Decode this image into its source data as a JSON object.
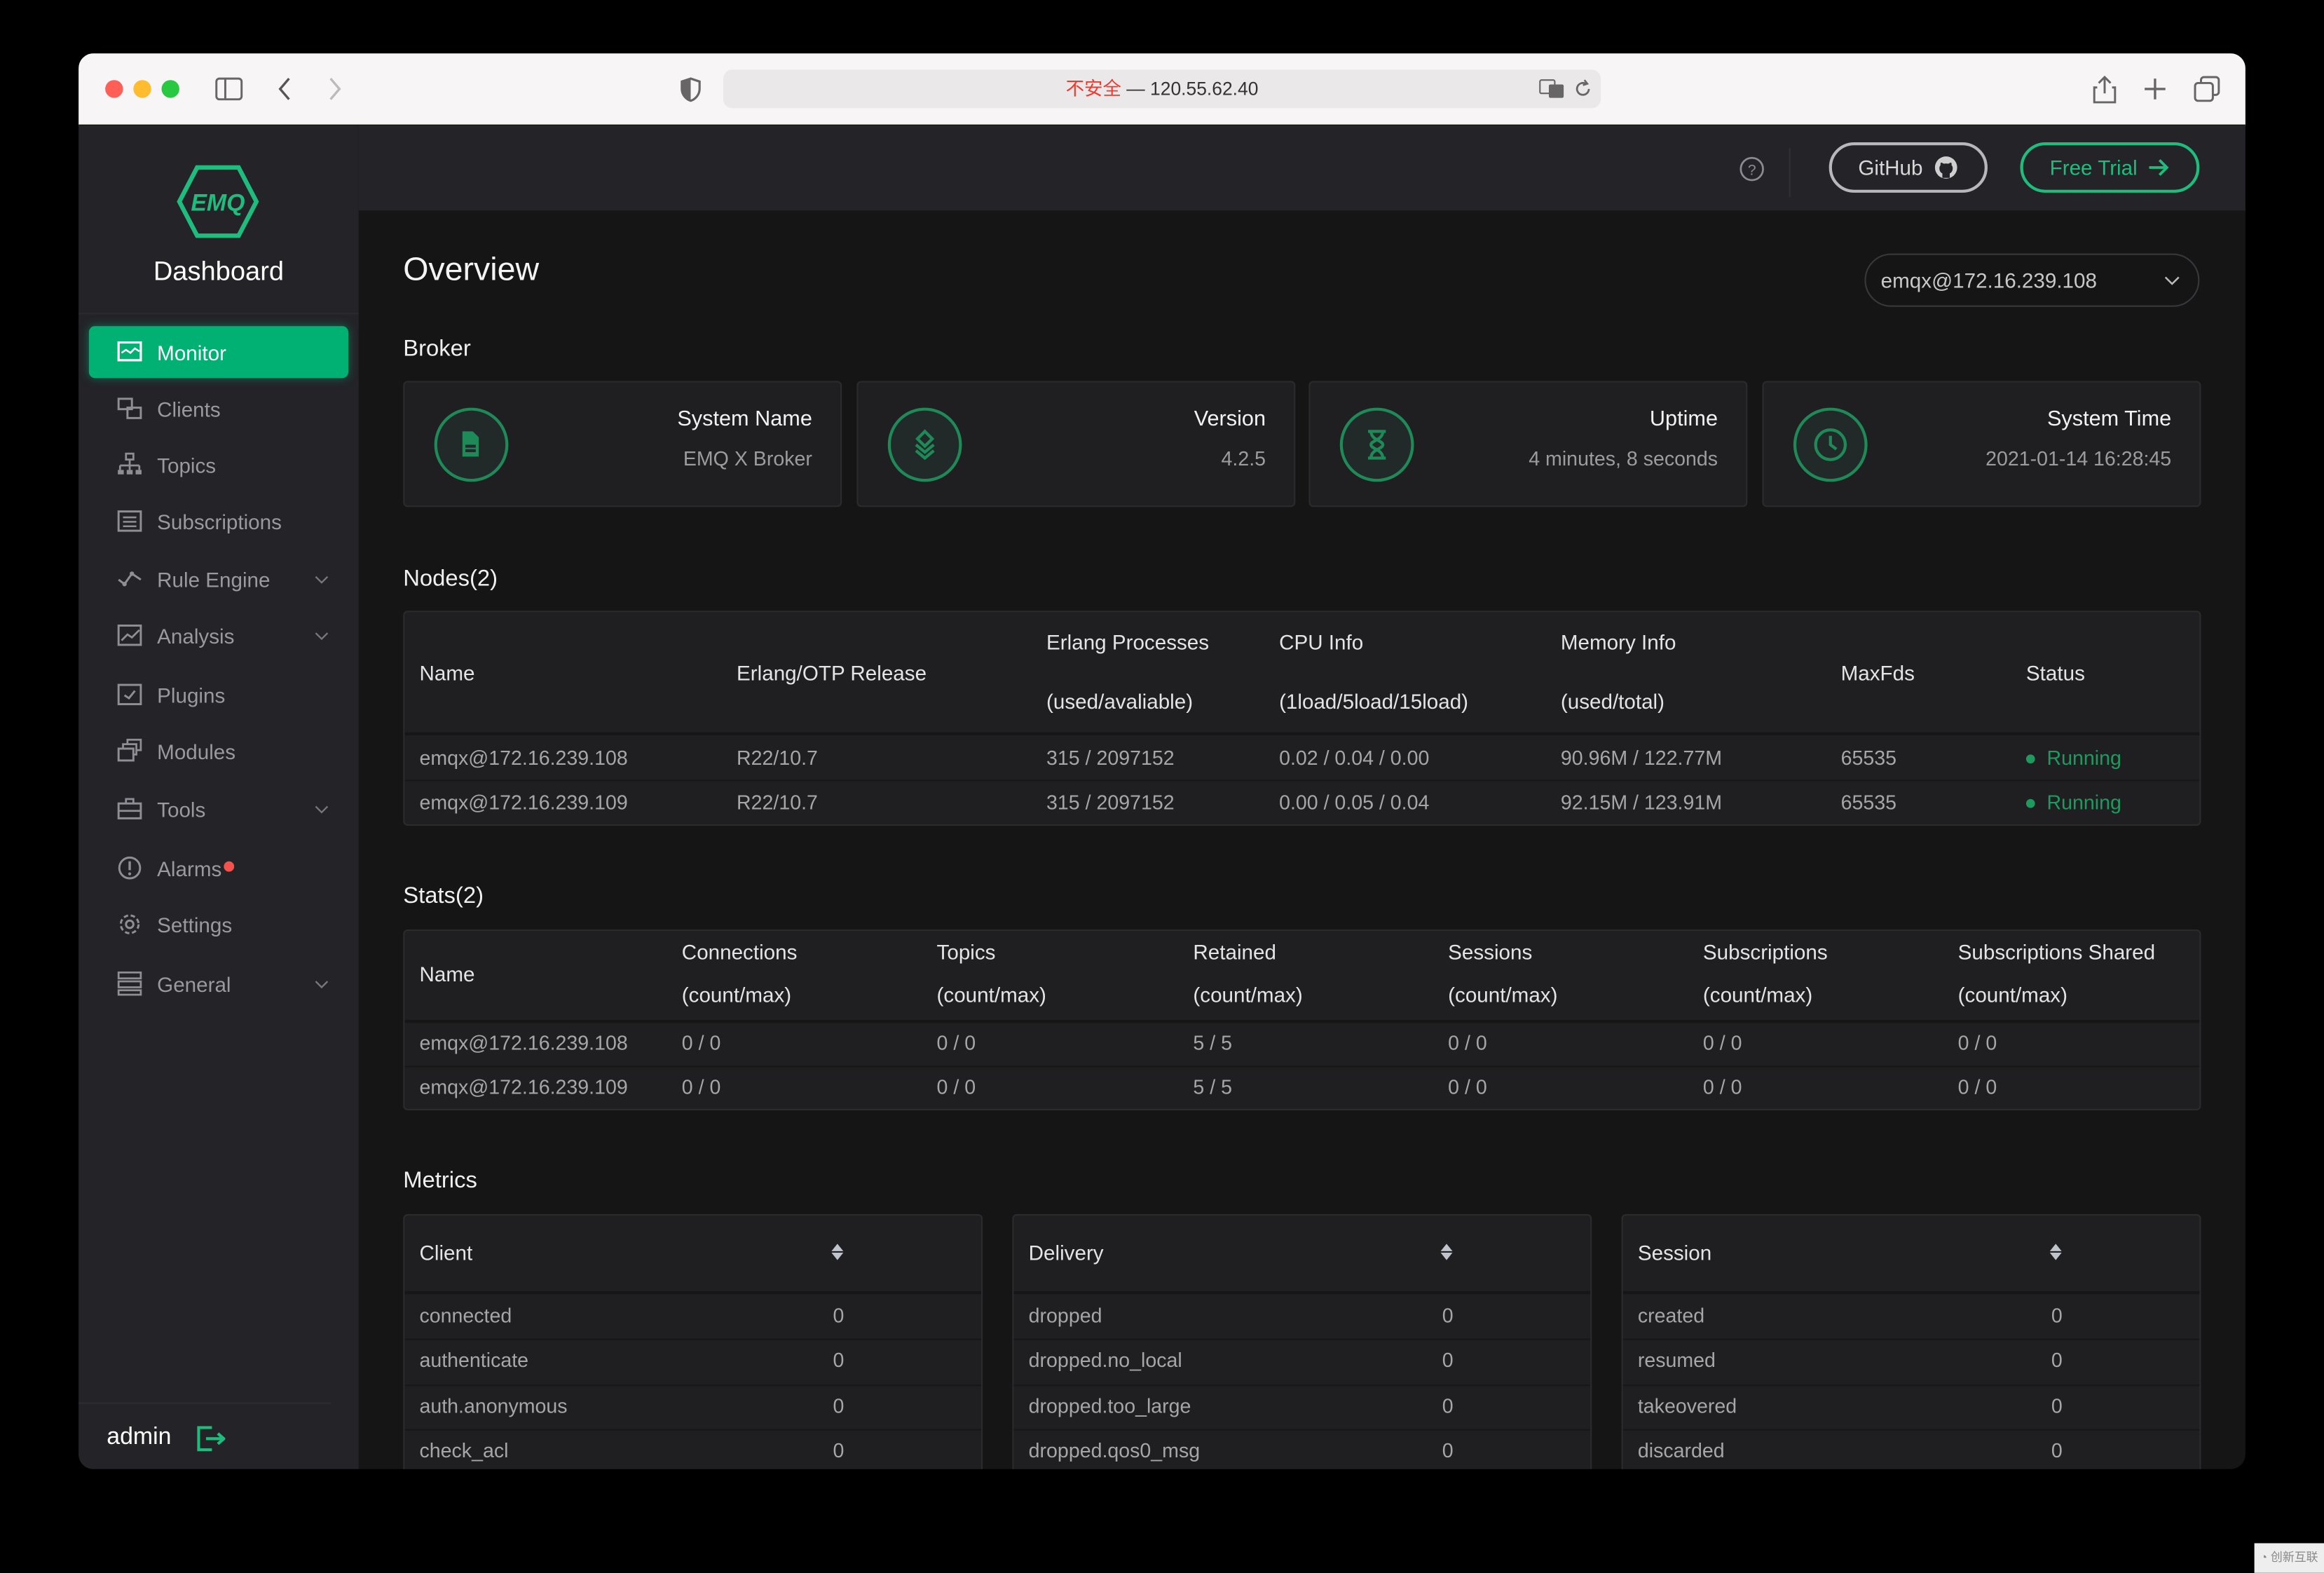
{
  "browser": {
    "address_insecure": "不安全",
    "address_sep": " — ",
    "address_host": "120.55.62.40"
  },
  "sidebar": {
    "logo_text": "EMQ",
    "title": "Dashboard",
    "items": [
      {
        "label": "Monitor",
        "icon": "monitor-icon",
        "active": true
      },
      {
        "label": "Clients",
        "icon": "clients-icon"
      },
      {
        "label": "Topics",
        "icon": "topics-icon"
      },
      {
        "label": "Subscriptions",
        "icon": "subscriptions-icon"
      },
      {
        "label": "Rule Engine",
        "icon": "rule-engine-icon",
        "expandable": true
      },
      {
        "label": "Analysis",
        "icon": "analysis-icon",
        "expandable": true
      },
      {
        "label": "Plugins",
        "icon": "plugins-icon"
      },
      {
        "label": "Modules",
        "icon": "modules-icon"
      },
      {
        "label": "Tools",
        "icon": "tools-icon",
        "expandable": true
      },
      {
        "label": "Alarms",
        "icon": "alarm-icon",
        "badge_dot": true
      },
      {
        "label": "Settings",
        "icon": "gear-icon"
      },
      {
        "label": "General",
        "icon": "general-icon",
        "expandable": true
      }
    ],
    "user": "admin"
  },
  "header": {
    "github_label": "GitHub",
    "free_trial_label": "Free Trial"
  },
  "page": {
    "title": "Overview",
    "node_select": "emqx@172.16.239.108",
    "broker_label": "Broker",
    "nodes_label": "Nodes(2)",
    "stats_label": "Stats(2)",
    "metrics_label": "Metrics"
  },
  "broker_cards": [
    {
      "title": "System Name",
      "value": "EMQ X Broker",
      "icon": "document-icon"
    },
    {
      "title": "Version",
      "value": "4.2.5",
      "icon": "layers-icon"
    },
    {
      "title": "Uptime",
      "value": "4 minutes, 8 seconds",
      "icon": "hourglass-icon"
    },
    {
      "title": "System Time",
      "value": "2021-01-14 16:28:45",
      "icon": "clock-icon"
    }
  ],
  "nodes": {
    "columns": [
      {
        "l1": "Name"
      },
      {
        "l1": "Erlang/OTP Release"
      },
      {
        "l1": "Erlang Processes",
        "l2": "(used/avaliable)"
      },
      {
        "l1": "CPU Info",
        "l2": "(1load/5load/15load)"
      },
      {
        "l1": "Memory Info",
        "l2": "(used/total)"
      },
      {
        "l1": "MaxFds"
      },
      {
        "l1": "Status"
      }
    ],
    "rows": [
      [
        "emqx@172.16.239.108",
        "R22/10.7",
        "315 / 2097152",
        "0.02 / 0.04 / 0.00",
        "90.96M / 122.77M",
        "65535",
        "Running"
      ],
      [
        "emqx@172.16.239.109",
        "R22/10.7",
        "315 / 2097152",
        "0.00 / 0.05 / 0.04",
        "92.15M / 123.91M",
        "65535",
        "Running"
      ]
    ]
  },
  "stats": {
    "columns": [
      {
        "l1": "Name"
      },
      {
        "l1": "Connections",
        "l2": "(count/max)"
      },
      {
        "l1": "Topics",
        "l2": "(count/max)"
      },
      {
        "l1": "Retained",
        "l2": "(count/max)"
      },
      {
        "l1": "Sessions",
        "l2": "(count/max)"
      },
      {
        "l1": "Subscriptions",
        "l2": "(count/max)"
      },
      {
        "l1": "Subscriptions Shared",
        "l2": "(count/max)"
      }
    ],
    "rows": [
      [
        "emqx@172.16.239.108",
        "0 / 0",
        "0 / 0",
        "5 / 5",
        "0 / 0",
        "0 / 0",
        "0 / 0"
      ],
      [
        "emqx@172.16.239.109",
        "0 / 0",
        "0 / 0",
        "5 / 5",
        "0 / 0",
        "0 / 0",
        "0 / 0"
      ]
    ]
  },
  "metrics": [
    {
      "title": "Client",
      "rows": [
        [
          "connected",
          "0"
        ],
        [
          "authenticate",
          "0"
        ],
        [
          "auth.anonymous",
          "0"
        ],
        [
          "check_acl",
          "0"
        ]
      ]
    },
    {
      "title": "Delivery",
      "rows": [
        [
          "dropped",
          "0"
        ],
        [
          "dropped.no_local",
          "0"
        ],
        [
          "dropped.too_large",
          "0"
        ],
        [
          "dropped.qos0_msg",
          "0"
        ]
      ]
    },
    {
      "title": "Session",
      "rows": [
        [
          "created",
          "0"
        ],
        [
          "resumed",
          "0"
        ],
        [
          "takeovered",
          "0"
        ],
        [
          "discarded",
          "0"
        ]
      ]
    }
  ],
  "watermark": "创新互联",
  "colors": {
    "accent": "#00b173",
    "running": "#1e9a5e",
    "alarm_dot": "#f5524e",
    "sidebar_bg": "#232328",
    "main_bg": "#151516"
  }
}
